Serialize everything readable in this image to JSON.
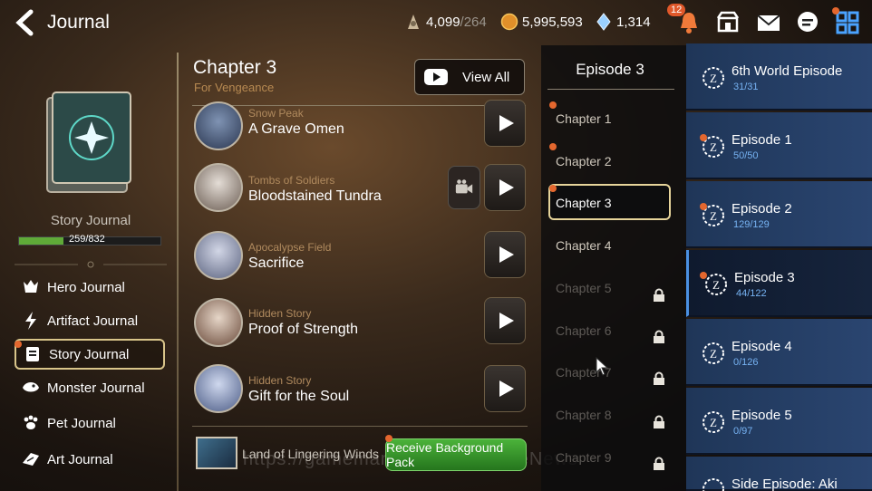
{
  "topbar": {
    "title": "Journal",
    "stamina": "4,099",
    "stamina_max": "/264",
    "gold": "5,995,593",
    "crystals": "1,314",
    "notification_count": "12"
  },
  "left": {
    "journal_label": "Story Journal",
    "progress_text": "259/832",
    "progress_value": 0.311,
    "menu": [
      {
        "label": "Hero Journal"
      },
      {
        "label": "Artifact Journal"
      },
      {
        "label": "Story Journal"
      },
      {
        "label": "Monster Journal"
      },
      {
        "label": "Pet Journal"
      },
      {
        "label": "Art Journal"
      }
    ]
  },
  "center": {
    "chapter_title": "Chapter 3",
    "chapter_subtitle": "For Vengeance",
    "view_all_label": "View All",
    "stories": [
      {
        "category": "Snow Peak",
        "name": "A Grave Omen"
      },
      {
        "category": "Tombs of Soldiers",
        "name": "Bloodstained Tundra"
      },
      {
        "category": "Apocalypse Field",
        "name": "Sacrifice"
      },
      {
        "category": "Hidden Story",
        "name": "Proof of Strength"
      },
      {
        "category": "Hidden Story",
        "name": "Gift for the Soul"
      }
    ],
    "background_name": "Land of Lingering Winds",
    "receive_label": "Receive Background Pack",
    "watermark": "https://gamemaniacs.com/GameNews"
  },
  "episode_panel": {
    "title": "Episode 3",
    "chapters": [
      {
        "label": "Chapter 1"
      },
      {
        "label": "Chapter 2"
      },
      {
        "label": "Chapter 3"
      },
      {
        "label": "Chapter 4"
      },
      {
        "label": "Chapter 5"
      },
      {
        "label": "Chapter 6"
      },
      {
        "label": "Chapter 7"
      },
      {
        "label": "Chapter 8"
      },
      {
        "label": "Chapter 9"
      }
    ]
  },
  "episodes": [
    {
      "name": "6th World Episode",
      "progress": "31/31"
    },
    {
      "name": "Episode 1",
      "progress": "50/50"
    },
    {
      "name": "Episode 2",
      "progress": "129/129"
    },
    {
      "name": "Episode 3",
      "progress": "44/122"
    },
    {
      "name": "Episode 4",
      "progress": "0/126"
    },
    {
      "name": "Episode 5",
      "progress": "0/97"
    },
    {
      "name": "Side Episode: Aki",
      "progress": ""
    }
  ],
  "colors": {
    "accent_gold": "#e6d49a",
    "episode_blue": "#2a4570",
    "progress_green": "#5faa38",
    "notify_orange": "#e4672e"
  }
}
